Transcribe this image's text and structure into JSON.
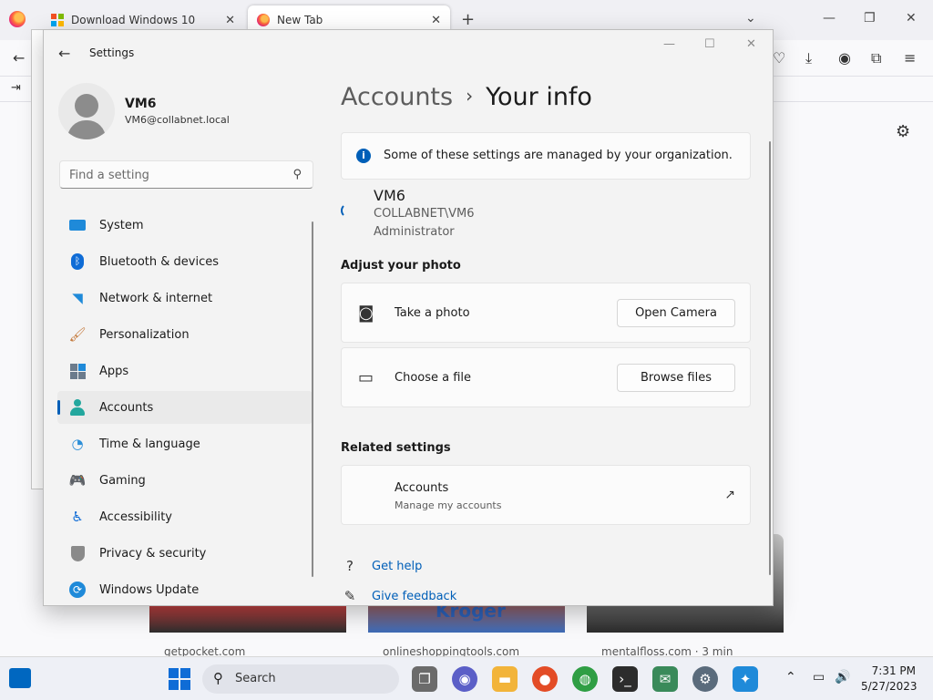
{
  "browser": {
    "tabs": [
      {
        "title": "Download Windows 10",
        "close": "✕"
      },
      {
        "title": "New Tab",
        "close": "✕"
      }
    ],
    "new_tab": "+",
    "tab_list": "⌄",
    "window_controls": {
      "minimize": "—",
      "restore": "❐",
      "close": "✕"
    },
    "feed_captions": [
      "getpocket.com",
      "onlineshoppingtools.com",
      "mentalfloss.com · 3 min"
    ],
    "kroger_text": "Kroger"
  },
  "settings": {
    "window_title": "Settings",
    "back": "←",
    "window_controls": {
      "minimize": "—",
      "maximize": "☐",
      "close": "✕"
    },
    "profile": {
      "name": "VM6",
      "email": "VM6@collabnet.local"
    },
    "search": {
      "placeholder": "Find a setting",
      "icon": "⚲"
    },
    "nav": [
      {
        "label": "System",
        "icon": "system-icon"
      },
      {
        "label": "Bluetooth & devices",
        "icon": "bluetooth-icon"
      },
      {
        "label": "Network & internet",
        "icon": "wifi-icon"
      },
      {
        "label": "Personalization",
        "icon": "brush-icon"
      },
      {
        "label": "Apps",
        "icon": "apps-icon"
      },
      {
        "label": "Accounts",
        "icon": "accounts-icon",
        "active": true
      },
      {
        "label": "Time & language",
        "icon": "globe-clock-icon"
      },
      {
        "label": "Gaming",
        "icon": "gamepad-icon"
      },
      {
        "label": "Accessibility",
        "icon": "accessibility-icon"
      },
      {
        "label": "Privacy & security",
        "icon": "shield-icon"
      },
      {
        "label": "Windows Update",
        "icon": "update-icon"
      }
    ],
    "breadcrumb": {
      "parent": "Accounts",
      "separator": "›",
      "current": "Your info"
    },
    "info_banner": "Some of these settings are managed by your organization.",
    "account": {
      "name": "VM6",
      "domain_user": "COLLABNET\\VM6",
      "role": "Administrator"
    },
    "adjust_photo": {
      "heading": "Adjust your photo",
      "take_photo": {
        "label": "Take a photo",
        "button": "Open Camera"
      },
      "choose_file": {
        "label": "Choose a file",
        "button": "Browse files"
      }
    },
    "related": {
      "heading": "Related settings",
      "accounts": {
        "label": "Accounts",
        "sub": "Manage my accounts"
      }
    },
    "help": {
      "get_help": "Get help",
      "feedback": "Give feedback"
    },
    "accent": "#005fb8"
  },
  "taskbar": {
    "search_label": "Search",
    "time": "7:31 PM",
    "date": "5/27/2023"
  }
}
